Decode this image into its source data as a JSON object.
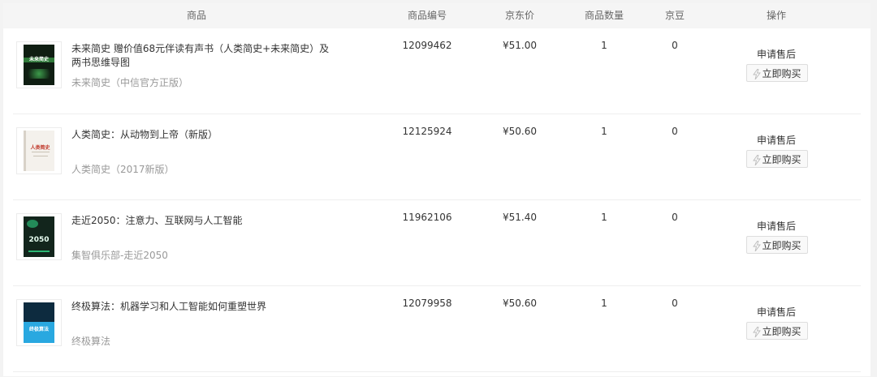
{
  "header": {
    "product": "商品",
    "sku": "商品编号",
    "price": "京东价",
    "quantity": "商品数量",
    "jingdou": "京豆",
    "action": "操作"
  },
  "items": [
    {
      "title": "未来简史 赠价值68元伴读有声书（人类简史+未来简史）及 两书思维导图",
      "subtitle": "未来简史（中信官方正版）",
      "sku": "12099462",
      "price": "¥51.00",
      "quantity": "1",
      "jingdou": "0",
      "aftersale": "申请售后",
      "buy": "立即购买",
      "cover_text": "未来简史",
      "cover_bg": "#0f1e12",
      "cover_accent": "#2f7a3a",
      "icon": "book-cover-icon"
    },
    {
      "title": "人类简史：从动物到上帝（新版）",
      "subtitle": "人类简史（2017新版）",
      "sku": "12125924",
      "price": "¥50.60",
      "quantity": "1",
      "jingdou": "0",
      "aftersale": "申请售后",
      "buy": "立即购买",
      "cover_text": "人类简史",
      "cover_bg": "#f4f1ec",
      "cover_accent": "#c0392b",
      "icon": "book-cover-icon"
    },
    {
      "title": "走近2050：注意力、互联网与人工智能",
      "subtitle": "集智俱乐部-走近2050",
      "sku": "11962106",
      "price": "¥51.40",
      "quantity": "1",
      "jingdou": "0",
      "aftersale": "申请售后",
      "buy": "立即购买",
      "cover_text": "2050",
      "cover_bg": "#12251c",
      "cover_accent": "#2bb673",
      "icon": "book-cover-icon"
    },
    {
      "title": "终极算法：机器学习和人工智能如何重塑世界",
      "subtitle": "终极算法",
      "sku": "12079958",
      "price": "¥50.60",
      "quantity": "1",
      "jingdou": "0",
      "aftersale": "申请售后",
      "buy": "立即购买",
      "cover_text": "终极算法",
      "cover_bg": "#0d2b3f",
      "cover_accent": "#29a8e0",
      "icon": "book-cover-icon"
    }
  ],
  "colors": {
    "page_bg": "#f3f3f3",
    "header_bg": "#f5f5f5",
    "subtitle": "#999999",
    "border": "#dddddd"
  }
}
